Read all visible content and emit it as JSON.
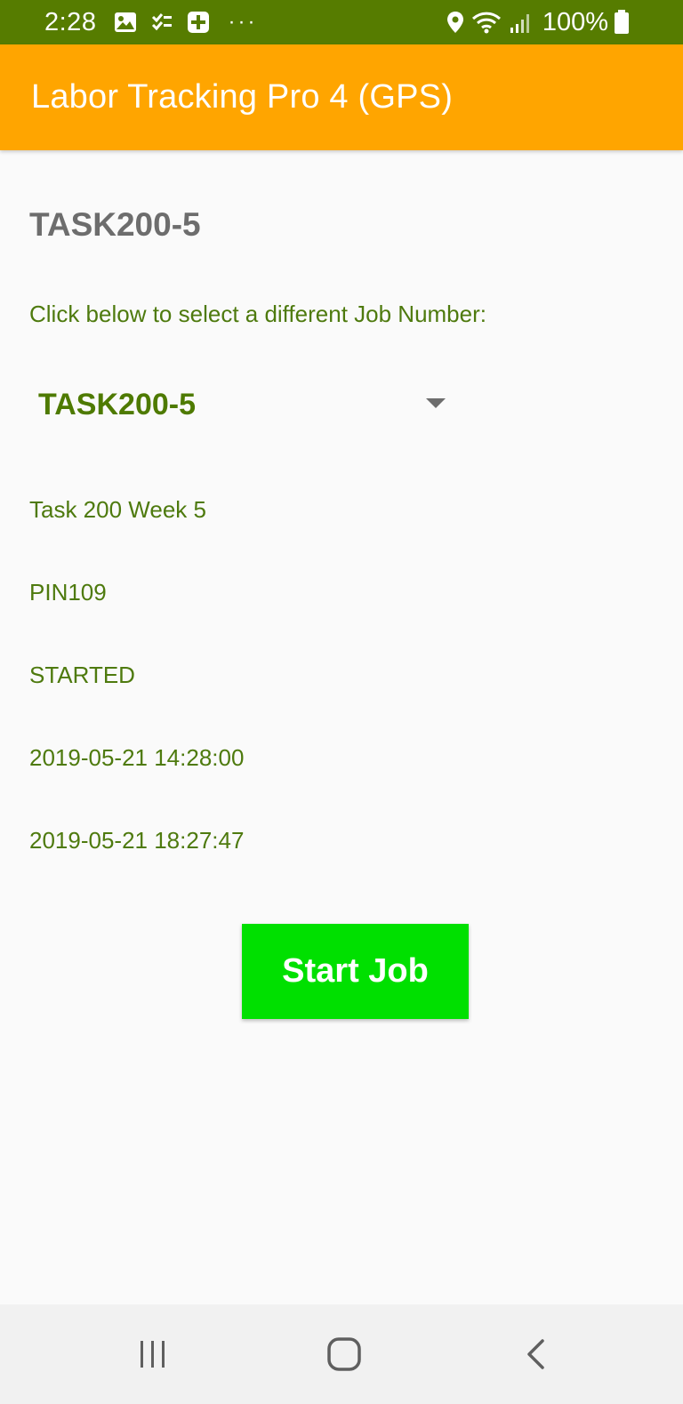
{
  "status_bar": {
    "time": "2:28",
    "more_dots": "···",
    "battery_percent": "100%",
    "icons": [
      "image-icon",
      "checklist-icon",
      "plus-box-icon",
      "location-icon",
      "wifi-icon",
      "signal-icon",
      "battery-icon"
    ]
  },
  "app_bar": {
    "title": "Labor Tracking Pro 4 (GPS)"
  },
  "job": {
    "heading": "TASK200-5",
    "select_prompt": "Click below to select a different Job Number:",
    "spinner_value": "TASK200-5",
    "description": "Task 200 Week 5",
    "pin": "PIN109",
    "status": "STARTED",
    "start_time": "2019-05-21 14:28:00",
    "current_time": "2019-05-21 18:27:47"
  },
  "actions": {
    "start_label": "Start Job"
  },
  "colors": {
    "status_bar": "#567c00",
    "app_bar": "#ffa500",
    "accent_text": "#4e7a0e",
    "heading_text": "#6d6d6d",
    "start_button": "#00e000",
    "nav_bar": "#f1f1f1"
  },
  "nav_bar": {
    "icons": [
      "recent-apps-icon",
      "home-icon",
      "back-icon"
    ]
  }
}
